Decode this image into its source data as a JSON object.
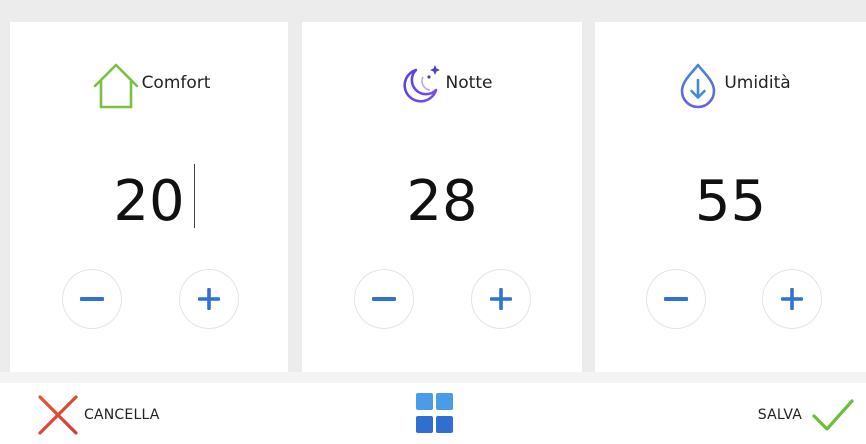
{
  "cards": [
    {
      "label": "Comfort",
      "value": "20",
      "icon": "home-icon",
      "accent": "#7ac142"
    },
    {
      "label": "Notte",
      "value": "28",
      "icon": "moon-stars-icon",
      "accent": "#4b3fd1"
    },
    {
      "label": "Umidità",
      "value": "55",
      "icon": "water-drop-down-icon",
      "accent": "#3f8ad8"
    }
  ],
  "stepper": {
    "minus_color": "#2f72d2",
    "plus_color": "#2f72d2"
  },
  "footer": {
    "cancel_label": "CANCELLA",
    "save_label": "SALVA",
    "cancel_color": "#e3452e",
    "save_color": "#6bbf3a",
    "grid_color": "#3d8be0"
  }
}
